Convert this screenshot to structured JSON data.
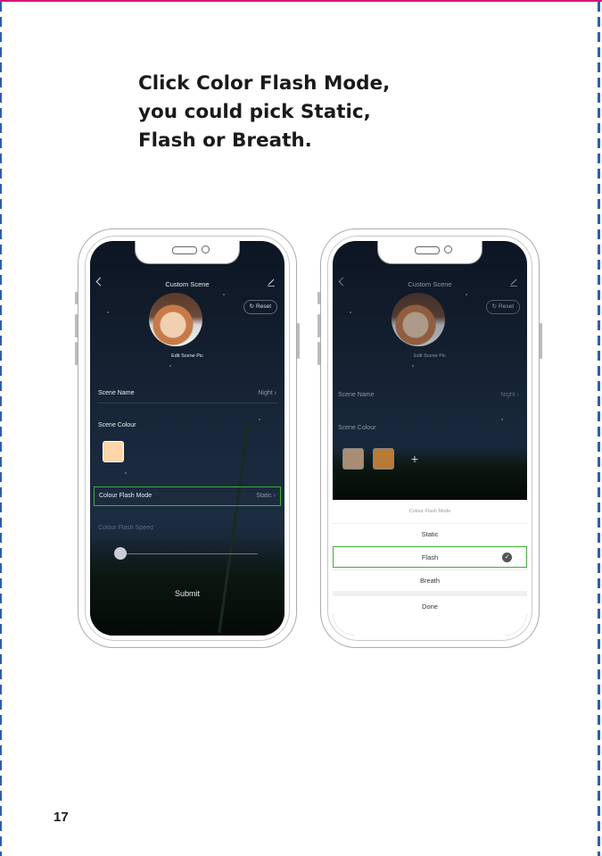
{
  "heading": {
    "lines": [
      "Click Color Flash Mode,",
      "you could pick Static,",
      "Flash or Breath."
    ]
  },
  "page_number": "17",
  "phone_left": {
    "nav_title": "Custom Scene",
    "reset_label": "Reset",
    "edit_pic_label": "Edit Scene Pic",
    "scene_name_label": "Scene Name",
    "scene_name_value": "Night",
    "scene_colour_label": "Scene Colour",
    "swatch_color": "#fcd6aa",
    "flash_mode_label": "Colour Flash Mode",
    "flash_mode_value": "Static",
    "flash_speed_label": "Colour Flash Speed",
    "submit_label": "Submit",
    "accent_color": "#3fae3a"
  },
  "phone_right": {
    "nav_title": "Custom Scene",
    "reset_label": "Reset",
    "edit_pic_label": "Edit Scene Pic",
    "scene_name_label": "Scene Name",
    "scene_name_value": "Night",
    "scene_colour_label": "Scene Colour",
    "swatches": [
      "#a88d74",
      "#b87a35"
    ],
    "sheet_title": "Colour Flash Mode",
    "options": [
      "Static",
      "Flash",
      "Breath"
    ],
    "selected_option": "Flash",
    "done_label": "Done"
  }
}
